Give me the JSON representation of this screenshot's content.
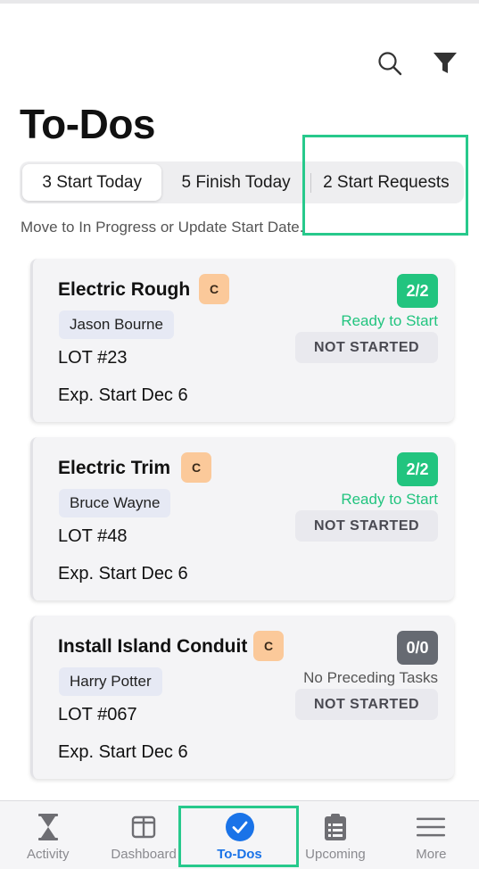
{
  "header": {
    "title": "To-Dos",
    "search_icon": "search-icon",
    "filter_icon": "filter-icon"
  },
  "tabs": [
    {
      "label": "3 Start Today",
      "active": true
    },
    {
      "label": "5 Finish Today",
      "active": false
    },
    {
      "label": "2 Start Requests",
      "active": false
    }
  ],
  "subtitle": "Move to In Progress or Update Start Date.",
  "cards": [
    {
      "title": "Electric Rough",
      "category": "C",
      "assignee": "Jason Bourne",
      "lot": "LOT #23",
      "expected_start": "Exp. Start Dec 6",
      "count": "2/2",
      "readiness": "Ready to Start",
      "status": "NOT STARTED"
    },
    {
      "title": "Electric Trim",
      "category": "C",
      "assignee": "Bruce Wayne",
      "lot": "LOT #48",
      "expected_start": "Exp. Start Dec 6",
      "count": "2/2",
      "readiness": "Ready to Start",
      "status": "NOT STARTED"
    },
    {
      "title": "Install Island Conduit",
      "category": "C",
      "assignee": "Harry Potter",
      "lot": "LOT #067",
      "expected_start": "Exp. Start Dec 6",
      "count": "0/0",
      "readiness": "No Preceding Tasks",
      "status": "NOT STARTED"
    }
  ],
  "tabbar": [
    {
      "label": "Activity",
      "icon": "hourglass-icon"
    },
    {
      "label": "Dashboard",
      "icon": "dashboard-icon"
    },
    {
      "label": "To-Dos",
      "icon": "checkmark-circle-icon",
      "active": true
    },
    {
      "label": "Upcoming",
      "icon": "clipboard-icon"
    },
    {
      "label": "More",
      "icon": "menu-icon"
    }
  ],
  "colors": {
    "accent_green": "#22c47f",
    "highlight": "#27c98c",
    "active_tab": "#1a73e8",
    "category_badge": "#fbc99a"
  }
}
